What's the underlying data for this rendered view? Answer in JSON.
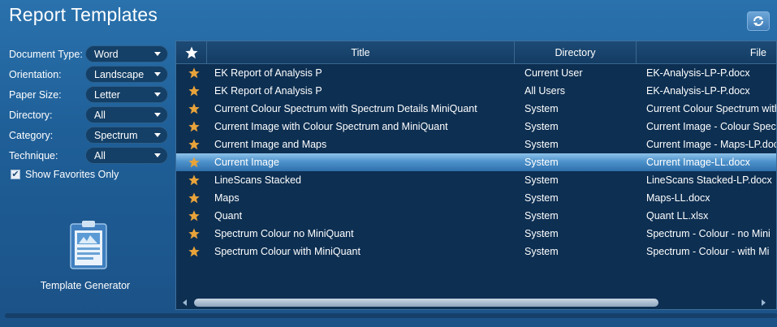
{
  "window": {
    "title": "Report Templates"
  },
  "filters": [
    {
      "label": "Document Type:",
      "value": "Word"
    },
    {
      "label": "Orientation:",
      "value": "Landscape"
    },
    {
      "label": "Paper Size:",
      "value": "Letter"
    },
    {
      "label": "Directory:",
      "value": "All"
    },
    {
      "label": "Category:",
      "value": "Spectrum"
    },
    {
      "label": "Technique:",
      "value": "All"
    }
  ],
  "favorites": {
    "label": "Show Favorites Only",
    "checked": true
  },
  "template_generator": {
    "label": "Template Generator"
  },
  "table": {
    "columns": [
      "Title",
      "Directory",
      "File"
    ],
    "rows": [
      {
        "title": "EK Report of Analysis P",
        "directory": "Current User",
        "file": "EK-Analysis-LP-P.docx"
      },
      {
        "title": "EK Report of Analysis P",
        "directory": "All Users",
        "file": "EK-Analysis-LP-P.docx"
      },
      {
        "title": "Current Colour Spectrum with Spectrum Details MiniQuant",
        "directory": "System",
        "file": "Current Colour Spectrum with"
      },
      {
        "title": "Current Image with Colour Spectrum and MiniQuant",
        "directory": "System",
        "file": "Current Image - Colour Spec"
      },
      {
        "title": "Current Image and Maps",
        "directory": "System",
        "file": "Current Image - Maps-LP.doc"
      },
      {
        "title": "Current Image",
        "directory": "System",
        "file": "Current Image-LL.docx",
        "selected": true
      },
      {
        "title": "LineScans Stacked",
        "directory": "System",
        "file": "LineScans Stacked-LP.docx"
      },
      {
        "title": "Maps",
        "directory": "System",
        "file": "Maps-LL.docx"
      },
      {
        "title": "Quant",
        "directory": "System",
        "file": "Quant LL.xlsx"
      },
      {
        "title": "Spectrum Colour no MiniQuant",
        "directory": "System",
        "file": "Spectrum - Colour - no Mini"
      },
      {
        "title": "Spectrum Colour with MiniQuant",
        "directory": "System",
        "file": "Spectrum - Colour - with Mi"
      }
    ]
  },
  "colors": {
    "accent": "#2a72ad",
    "star": "#e8a33a",
    "grid_bg": "#0d2f52",
    "selection": "#4e93cc"
  },
  "icons": {
    "refresh": "refresh-icon",
    "star": "star-icon",
    "favorite_header": "favorite-star-icon"
  }
}
